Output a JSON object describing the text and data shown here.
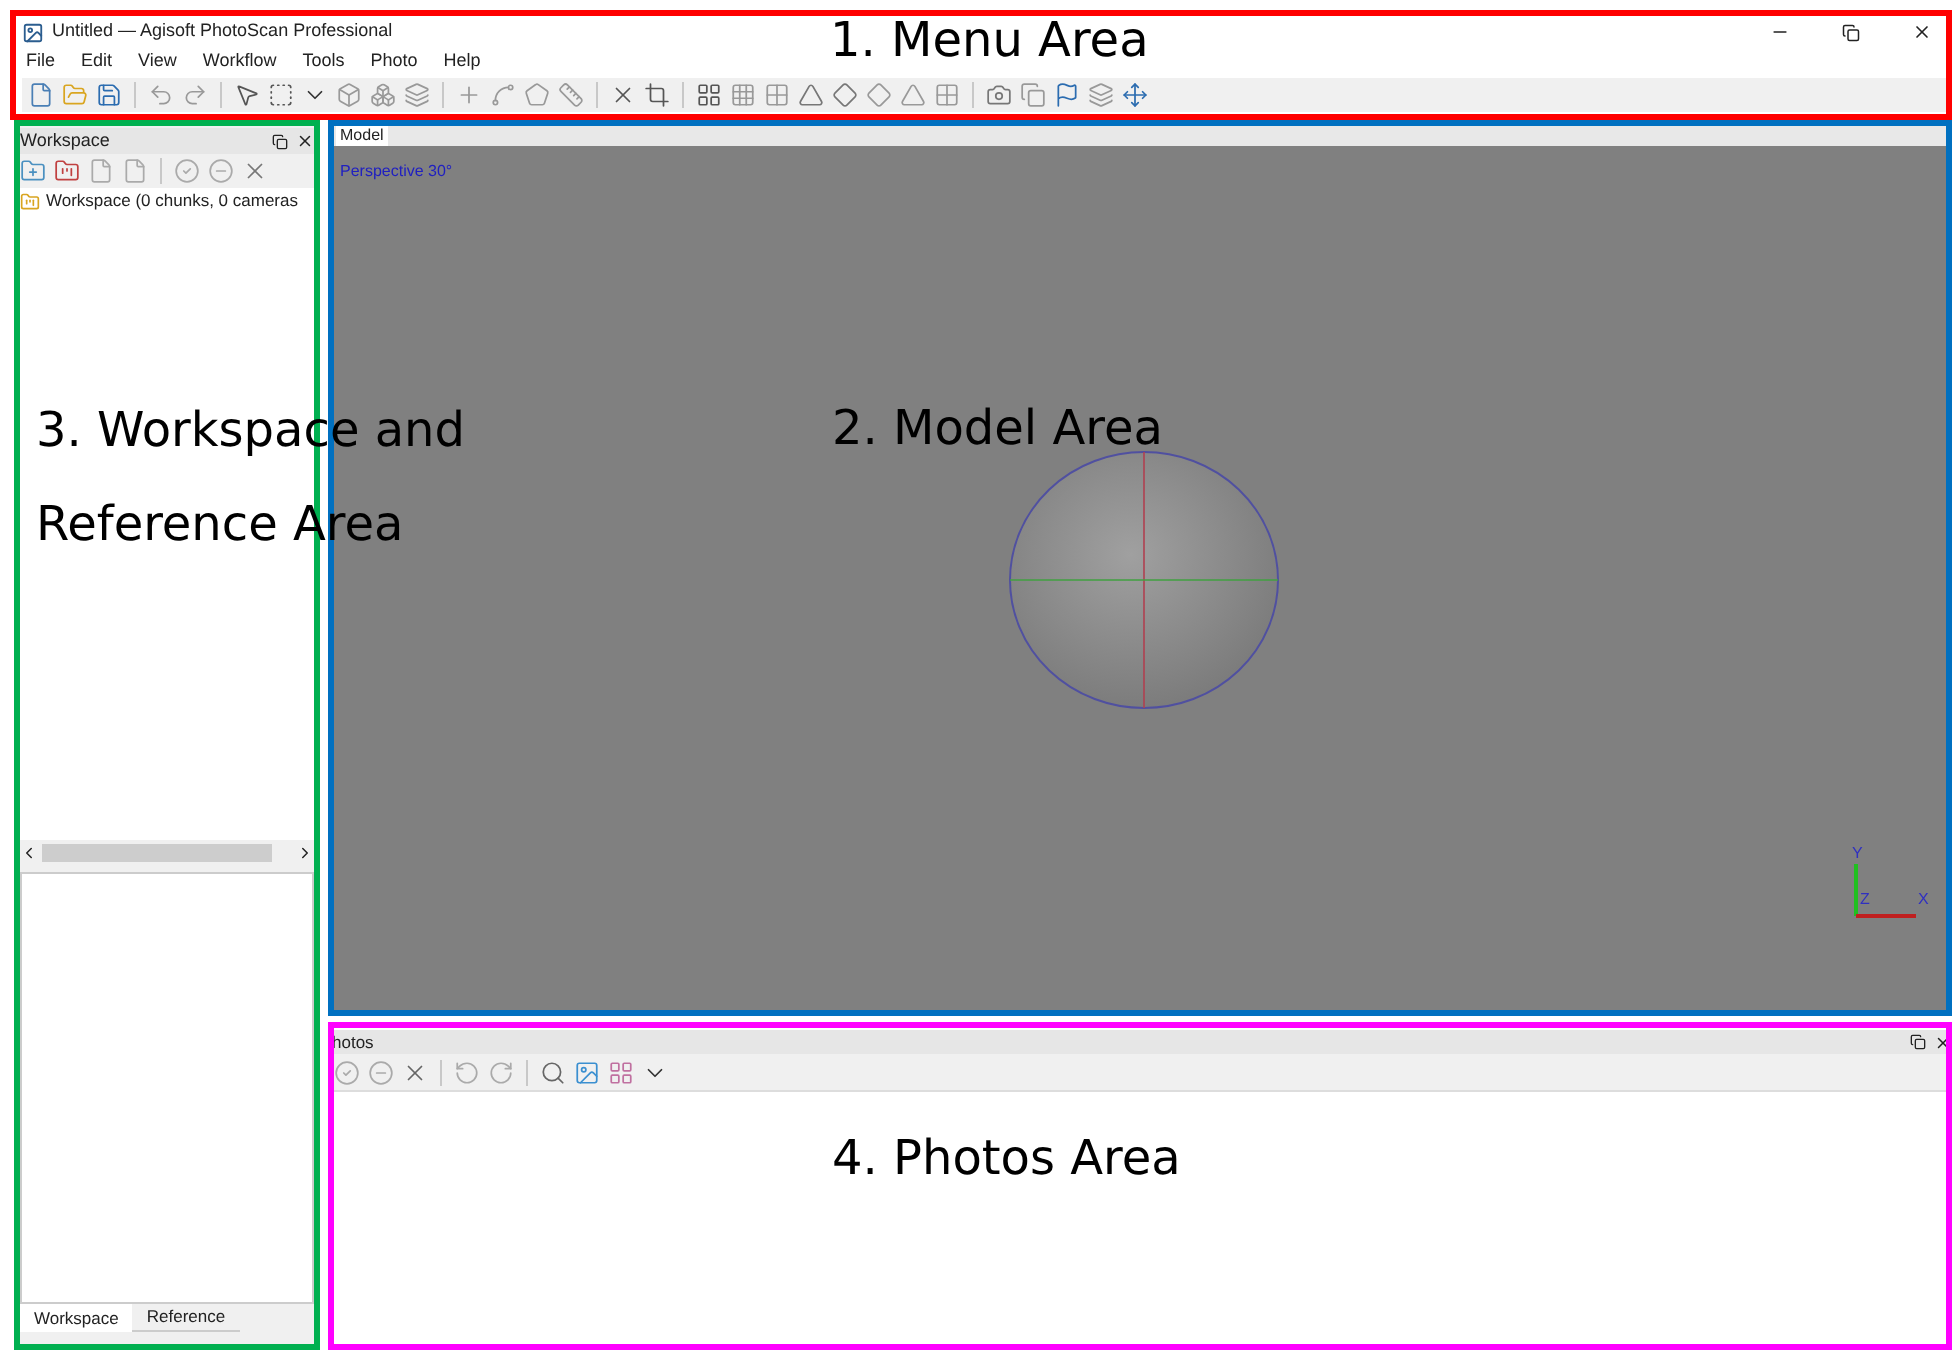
{
  "window": {
    "title": "Untitled — Agisoft PhotoScan Professional"
  },
  "menu": [
    "File",
    "Edit",
    "View",
    "Workflow",
    "Tools",
    "Photo",
    "Help"
  ],
  "workspace_panel": {
    "title": "Workspace",
    "tree_item": "Workspace (0 chunks, 0 cameras",
    "tabs": [
      {
        "label": "Workspace",
        "selected": true
      },
      {
        "label": "Reference",
        "selected": false
      }
    ]
  },
  "model_panel": {
    "tab": "Model",
    "view_label": "Perspective 30°",
    "axes": [
      "Y",
      "Z",
      "X"
    ]
  },
  "photos_panel": {
    "title": "hotos"
  },
  "annotations": [
    {
      "text": "1. Menu Area",
      "color": "#ff0000"
    },
    {
      "text": "3. Workspace and Reference Area",
      "color": "#00b050"
    },
    {
      "text": "2. Model Area",
      "color": "#0070c0"
    },
    {
      "text": "4. Photos Area",
      "color": "#ff00ff"
    }
  ]
}
